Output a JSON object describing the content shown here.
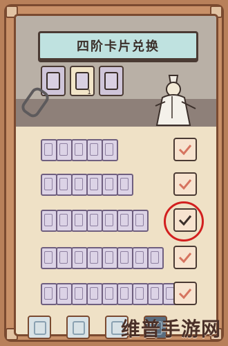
{
  "title": "四阶卡片兑换",
  "header": {
    "tabs": [
      {
        "name": "tab-card-1",
        "active": false,
        "count": ""
      },
      {
        "name": "tab-card-2",
        "active": true,
        "count": "1"
      },
      {
        "name": "tab-card-3",
        "active": false,
        "count": ""
      }
    ]
  },
  "rows": [
    {
      "cards": 5,
      "checked": true
    },
    {
      "cards": 6,
      "checked": true
    },
    {
      "cards": 7,
      "checked": true,
      "highlighted": true
    },
    {
      "cards": 8,
      "checked": true
    },
    {
      "cards": 9,
      "checked": true
    }
  ],
  "watermark": "维普手游网",
  "colors": {
    "highlight": "#d21f1f",
    "check": "#d6735f",
    "panel": "#efe1c6",
    "frame": "#7a4a30"
  }
}
